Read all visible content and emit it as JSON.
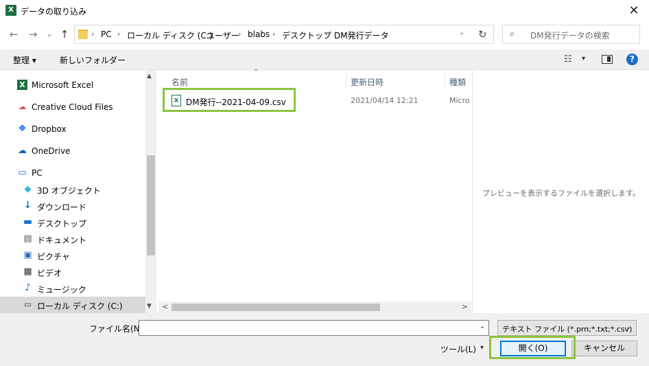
{
  "window": {
    "title": "データの取り込み",
    "app_icon": "X",
    "close_glyph": "✕"
  },
  "nav": {
    "back": "←",
    "forward": "→",
    "recent": "⌄",
    "up": "↑"
  },
  "address": {
    "crumbs": [
      "PC",
      "ローカル ディスク (C:)",
      "ユーザー",
      "blabs",
      "デスクトップ",
      "DM発行データ"
    ],
    "separator": "›",
    "refresh": "↻",
    "dropdown": "⌄"
  },
  "search": {
    "icon": "⌕",
    "placeholder": "DM発行データの検索"
  },
  "toolbar": {
    "organize": "整理 ▾",
    "new_folder": "新しいフォルダー",
    "view_icon": "☷",
    "view_dd": "▾",
    "help": "?"
  },
  "sidebar": {
    "items": [
      {
        "label": "Microsoft Excel",
        "icon": "X",
        "icon_name": "excel-icon"
      },
      {
        "label": "Creative Cloud Files",
        "icon": "☁",
        "icon_name": "creative-cloud-icon"
      },
      {
        "label": "Dropbox",
        "icon": "❖",
        "icon_name": "dropbox-icon"
      },
      {
        "label": "OneDrive",
        "icon": "☁",
        "icon_name": "onedrive-icon"
      },
      {
        "label": "PC",
        "icon": "▭",
        "icon_name": "pc-icon"
      },
      {
        "label": "3D オブジェクト",
        "icon": "◆",
        "icon_name": "3d-objects-icon"
      },
      {
        "label": "ダウンロード",
        "icon": "↓",
        "icon_name": "download-icon"
      },
      {
        "label": "デスクトップ",
        "icon": "▬",
        "icon_name": "desktop-icon"
      },
      {
        "label": "ドキュメント",
        "icon": "▤",
        "icon_name": "documents-icon"
      },
      {
        "label": "ピクチャ",
        "icon": "▣",
        "icon_name": "pictures-icon"
      },
      {
        "label": "ビデオ",
        "icon": "▦",
        "icon_name": "videos-icon"
      },
      {
        "label": "ミュージック",
        "icon": "♪",
        "icon_name": "music-icon"
      },
      {
        "label": "ローカル ディスク (C:)",
        "icon": "▭",
        "icon_name": "local-disk-icon"
      }
    ],
    "scroll_up": "▲",
    "scroll_down": "▼"
  },
  "filelist": {
    "sort_indicator": "^",
    "columns": [
      "名前",
      "更新日時",
      "種類"
    ],
    "rows": [
      {
        "name": "DM発行--2021-04-09.csv",
        "modified": "2021/04/14 12:21",
        "type": "Micro",
        "icon": "X"
      }
    ],
    "scroll_left": "<",
    "scroll_right": ">"
  },
  "preview": {
    "message": "プレビューを表示するファイルを選択します。"
  },
  "footer": {
    "filename_label": "ファイル名(N):",
    "filename_value": "",
    "filename_dd": "⌄",
    "filetype": "テキスト ファイル (*.prn;*.txt;*.csv)",
    "filetype_dd": "⌄",
    "tools": "ツール(L)",
    "tools_dd": "▾",
    "open": "開く(O)",
    "cancel": "キャンセル"
  },
  "colors": {
    "highlight": "#8ac43f",
    "excel_green": "#1d6f42",
    "accent": "#0078d7"
  }
}
